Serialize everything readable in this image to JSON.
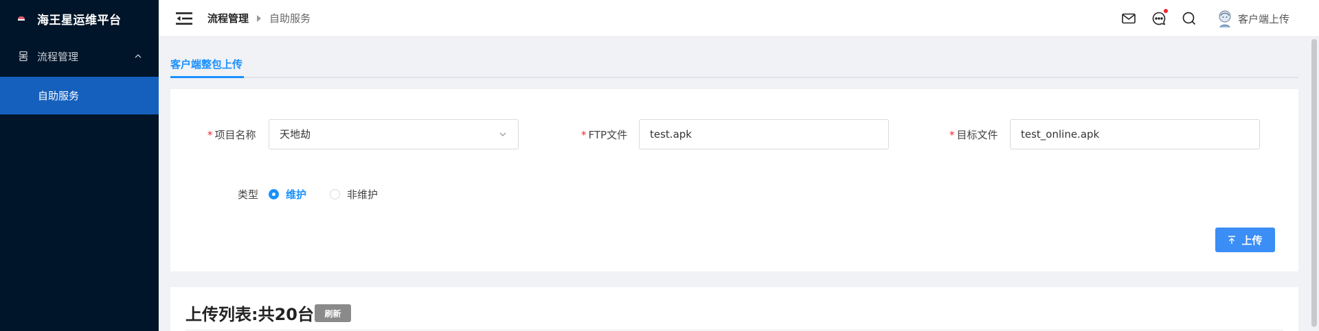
{
  "sidebar": {
    "brand_title": "海王星运维平台",
    "menu_group_label": "流程管理",
    "menu_item_label": "自助服务"
  },
  "header": {
    "breadcrumb_root": "流程管理",
    "breadcrumb_current": "自助服务",
    "user_name": "客户端上传",
    "has_notification_dot": true
  },
  "tabs": {
    "active_label": "客户端整包上传"
  },
  "form": {
    "project_label": "项目名称",
    "project_value": "天地劫",
    "ftp_label": "FTP文件",
    "ftp_value": "test.apk",
    "target_label": "目标文件",
    "target_value": "test_online.apk",
    "type_label": "类型",
    "type_options": [
      "维护",
      "非维护"
    ],
    "type_selected": "维护",
    "required_mark": "*",
    "upload_button": "上传"
  },
  "list": {
    "title": "上传列表:共20台",
    "refresh_button": "刷新"
  },
  "colors": {
    "sidebar_bg": "#001529",
    "sidebar_active": "#1560bd",
    "accent": "#1890ff",
    "required": "#f5222d"
  }
}
